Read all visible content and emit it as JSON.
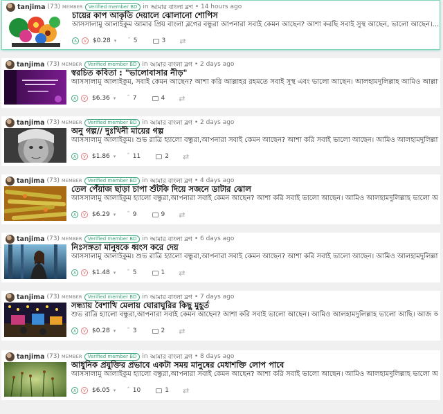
{
  "feed": {
    "posts": [
      {
        "author": "tanjima",
        "reputation": "(73)",
        "member_label": "MEMBER",
        "badge": "Verified member BD",
        "in_label": "in",
        "community": "আমার বাংলা ব্লগ",
        "time": "• 14 hours ago",
        "title": "চায়ের কাপ আকৃতি দেয়ালে ঝোলানো শোপিস",
        "excerpt": "আসসালামু আলাইকুম আমার প্রিয় বাংলা ব্লগের বন্ধুরা আপনারা সবাই কেমন আছেন? আশা করছি সবাই সুস্থ আছেন, ভালো আছেন।...",
        "payout": "$0.28",
        "votes": "5",
        "comments": "3",
        "thumb": "colorful-paper-flower-showpiece"
      },
      {
        "author": "tanjima",
        "reputation": "(73)",
        "member_label": "MEMBER",
        "badge": "Verified member BD",
        "in_label": "in",
        "community": "আমার বাংলা ব্লগ",
        "time": "• 2 days ago",
        "title": "স্বরচিত কবিতা : \"ভালোবাসার নীড়\"",
        "excerpt": "আসসালামু আলাইকুম, সবাই কেমন আছেন? আশা করি আল্লাহর রহমতে সবাই সুস্থ এবং ভালো আছেন। আলহামদুলিল্লাহ আমিও আল্লাহ...",
        "payout": "$6.36",
        "votes": "7",
        "comments": "4",
        "thumb": "purple-poem-banner"
      },
      {
        "author": "tanjima",
        "reputation": "(73)",
        "member_label": "MEMBER",
        "badge": "Verified member BD",
        "in_label": "in",
        "community": "আমার বাংলা ব্লগ",
        "time": "• 2 days ago",
        "title": "অনু গল্প// দুঃখিনী মায়ের গল্প",
        "excerpt": "আসসালামু আলাইকুম। শুভ রাত্রি হ্যালো বন্ধুরা,আপনারা সবাই কেমন আছেন? আশা করি সবাই ভালো আছেন। আমিও আলহামদুলিল্লাহ...",
        "payout": "$1.86",
        "votes": "11",
        "comments": "2",
        "thumb": "elderly-woman-portrait"
      },
      {
        "author": "tanjima",
        "reputation": "(73)",
        "member_label": "MEMBER",
        "badge": "Verified member BD",
        "in_label": "in",
        "community": "আমার বাংলা ব্লগ",
        "time": "• 4 days ago",
        "title": "তেল পেঁয়াজ ছাড়া চাপা শুঁটকি দিয়ে সজনে ডাটার ঝোল",
        "excerpt": "আসসালামু আলাইকুম হ্যালো বন্ধুরা,আপনারা সবাই কেমন আছেন? আশা করি সবাই ভালো আছেন। আমিও আলহামদুলিল্লাহ ভালো আছি...",
        "payout": "$6.29",
        "votes": "9",
        "comments": "9",
        "thumb": "drumstick-curry-dish"
      },
      {
        "author": "tanjima",
        "reputation": "(73)",
        "member_label": "MEMBER",
        "badge": "Verified member BD",
        "in_label": "in",
        "community": "আমার বাংলা ব্লগ",
        "time": "• 6 days ago",
        "title": "নিঃসঙ্গতা মানুষকে ধ্বংস করে দেয়",
        "excerpt": "আসসালামু আলাইকুম। শুভ রাত্রি হ্যালো বন্ধুরা,আপনারা সবাই কেমন আছেন? আশা করি সবাই ভালো আছেন। আমিও আলহামদুলিল্লাহ...",
        "payout": "$1.48",
        "votes": "5",
        "comments": "1",
        "thumb": "lonely-woman-forest"
      },
      {
        "author": "tanjima",
        "reputation": "(73)",
        "member_label": "MEMBER",
        "badge": "Verified member BD",
        "in_label": "in",
        "community": "আমার বাংলা ব্লগ",
        "time": "• 7 days ago",
        "title": "সন্ধ্যায় বৈশাখি মেলায় ঘোরাঘুরির কিছু মুহূর্ত",
        "excerpt": "শুভ রাত্রি হ্যালো বন্ধুরা,আপনারা সবাই কেমন আছেন? আশা করি সবাই ভালো আছেন। আমিও আলহামদুলিল্লাহ ভালো আছি। আজ আমা...",
        "payout": "$0.28",
        "votes": "3",
        "comments": "2",
        "thumb": "evening-fair-lights"
      },
      {
        "author": "tanjima",
        "reputation": "(73)",
        "member_label": "MEMBER",
        "badge": "Verified member BD",
        "in_label": "in",
        "community": "আমার বাংলা ব্লগ",
        "time": "• 8 days ago",
        "title": "আধুনিক প্রযুক্তির প্রভাবে একটা সময় মানুষের মেধাশক্তি লোপ পাবে",
        "excerpt": "আসসালামু আলাইকুম হ্যালো বন্ধুরা,আপনারা সবাই কেমন আছেন? আশা করি সবাই ভালো আছেন। আমিও আলহামদুলিল্লাহ ভালো আছি...",
        "payout": "$6.05",
        "votes": "10",
        "comments": "1",
        "thumb": "green-moss-closeup"
      }
    ]
  },
  "icons": {
    "upvote": "∧",
    "downvote": "∨",
    "caret": "▾",
    "votes": "ˆ",
    "resteem": "⇄"
  },
  "colors": {
    "accent": "#3aa57a",
    "downvote": "#e07a7a",
    "active_border": "#7fd6bd"
  }
}
